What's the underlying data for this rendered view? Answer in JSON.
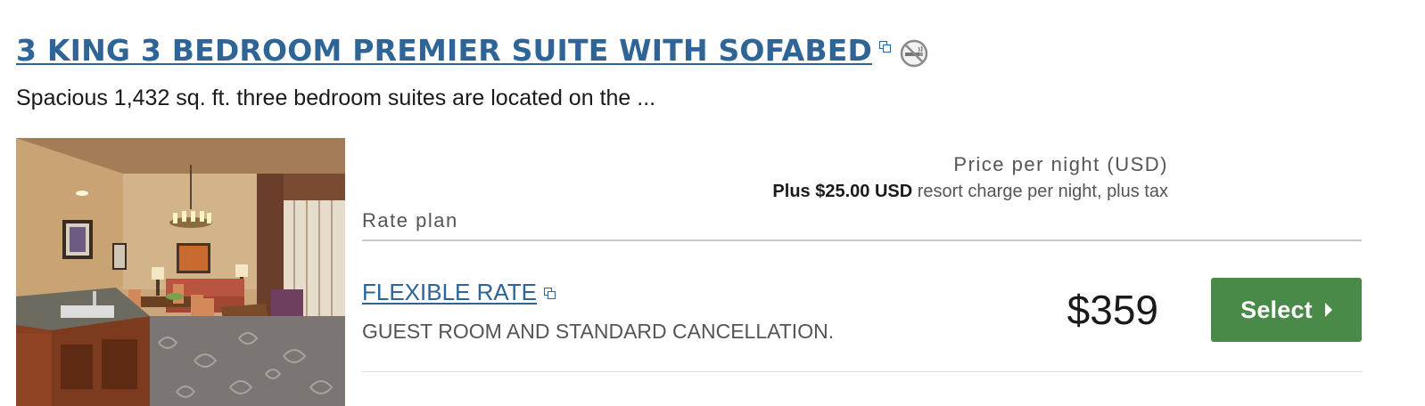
{
  "room": {
    "title": "3 KING 3 BEDROOM PREMIER SUITE WITH SOFABED",
    "description": "Spacious 1,432 sq. ft. three bedroom suites are located on the ...",
    "icons": [
      "external-link-icon",
      "no-smoking-icon"
    ]
  },
  "table_header": {
    "rate_plan": "Rate plan",
    "price_per_night": "Price per night (USD)",
    "resort_charge_bold": "Plus $25.00 USD",
    "resort_charge_rest": " resort charge per night, plus tax"
  },
  "rates": [
    {
      "name": "FLEXIBLE RATE",
      "description": "GUEST ROOM AND STANDARD CANCELLATION.",
      "price": "$359",
      "button_label": "Select"
    }
  ],
  "colors": {
    "link": "#2f6496",
    "select_button": "#4a8a49",
    "divider": "#c8c8c8"
  }
}
